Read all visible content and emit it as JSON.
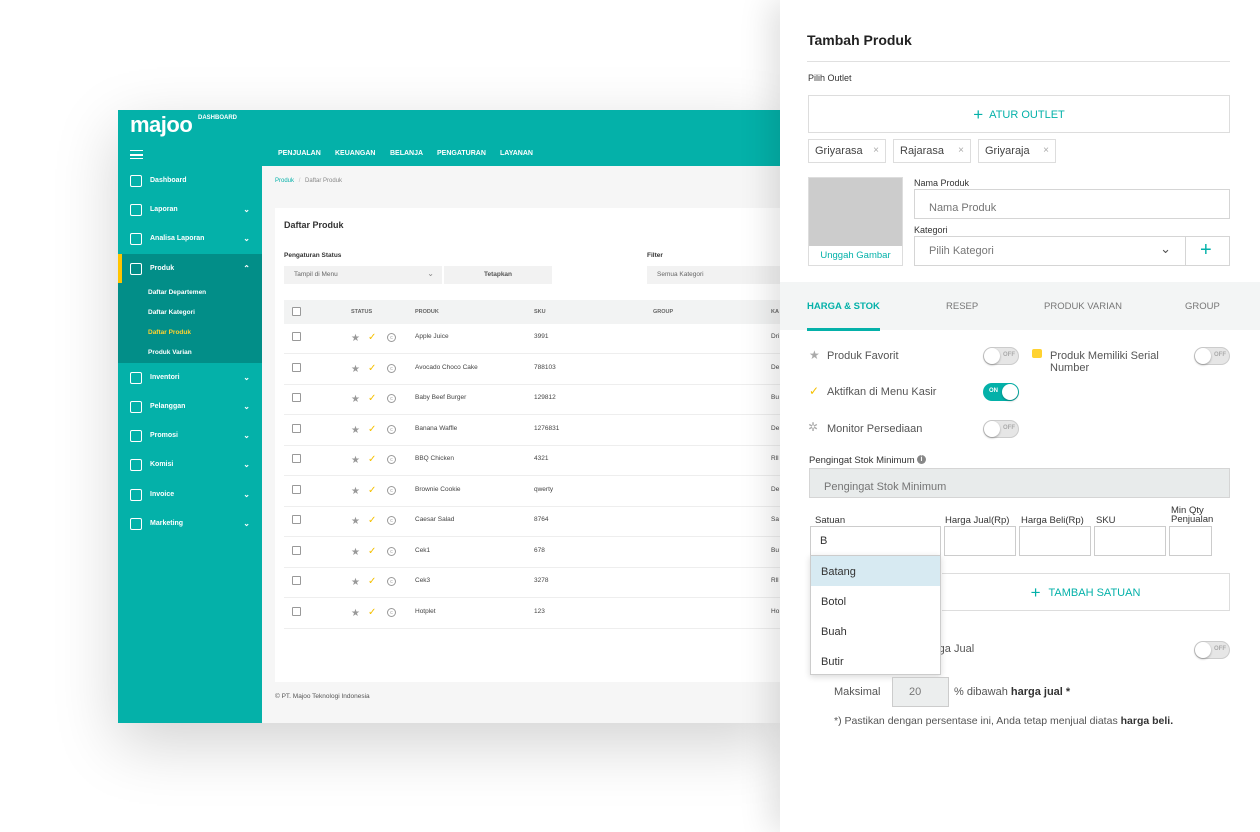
{
  "dashboard": {
    "logo": "majoo",
    "logo_sub": "DASHBOARD",
    "top_nav": [
      "PENJUALAN",
      "KEUANGAN",
      "BELANJA",
      "PENGATURAN",
      "LAYANAN"
    ],
    "sidebar": [
      {
        "label": "Dashboard",
        "icon": "grid-icon",
        "chevron": ""
      },
      {
        "label": "Laporan",
        "icon": "report-icon",
        "chevron": "⌄"
      },
      {
        "label": "Analisa Laporan",
        "icon": "analytics-icon",
        "chevron": "⌄"
      },
      {
        "label": "Produk",
        "icon": "bag-icon",
        "chevron": "⌃"
      },
      {
        "label": "Inventori",
        "icon": "inventory-icon",
        "chevron": "⌄"
      },
      {
        "label": "Pelanggan",
        "icon": "users-icon",
        "chevron": "⌄"
      },
      {
        "label": "Promosi",
        "icon": "ticket-icon",
        "chevron": "⌄"
      },
      {
        "label": "Komisi",
        "icon": "hand-coin-icon",
        "chevron": "⌄"
      },
      {
        "label": "Invoice",
        "icon": "dollar-icon",
        "chevron": "⌄"
      },
      {
        "label": "Marketing",
        "icon": "megaphone-icon",
        "chevron": "⌄"
      }
    ],
    "produk_sub": [
      "Daftar Departemen",
      "Daftar Kategori",
      "Daftar Produk",
      "Produk Varian"
    ],
    "breadcrumb": {
      "root": "Produk",
      "sep": "/",
      "current": "Daftar Produk"
    },
    "card_title": "Daftar Produk",
    "status_label": "Pengaturan Status",
    "status_value": "Tampil di Menu",
    "apply_label": "Tetapkan",
    "filter_label": "Filter",
    "filter_value": "Semua Kategori",
    "columns": [
      "STATUS",
      "PRODUK",
      "SKU",
      "GROUP",
      "KA"
    ],
    "rows": [
      {
        "produk": "Apple Juice",
        "sku": "3991",
        "ka": "Dri"
      },
      {
        "produk": "Avocado Choco Cake",
        "sku": "788103",
        "ka": "De"
      },
      {
        "produk": "Baby Beef Burger",
        "sku": "129812",
        "ka": "Bu"
      },
      {
        "produk": "Banana Waffle",
        "sku": "1276831",
        "ka": "De"
      },
      {
        "produk": "BBQ Chicken",
        "sku": "4321",
        "ka": "Rll"
      },
      {
        "produk": "Brownie Cookie",
        "sku": "qwerty",
        "ka": "De"
      },
      {
        "produk": "Caesar Salad",
        "sku": "8764",
        "ka": "Sa"
      },
      {
        "produk": "Cek1",
        "sku": "678",
        "ka": "Bu"
      },
      {
        "produk": "Cek3",
        "sku": "3278",
        "ka": "Rll"
      },
      {
        "produk": "Hotplet",
        "sku": "123",
        "ka": "Ho"
      }
    ],
    "footer": "© PT. Majoo Teknologi Indonesia",
    "colors": {
      "brand": "#04b1a9",
      "brand_dark": "#028e88",
      "accent": "#ffc400"
    }
  },
  "panel": {
    "title": "Tambah Produk",
    "pilih_outlet_label": "Pilih Outlet",
    "atur_outlet": "ATUR OUTLET",
    "outlets": [
      "Griyarasa",
      "Rajarasa",
      "Griyaraja"
    ],
    "chip_remove": "×",
    "upload_label": "Unggah Gambar",
    "nama_produk_label": "Nama Produk",
    "nama_produk_placeholder": "Nama Produk",
    "kategori_label": "Kategori",
    "kategori_placeholder": "Pilih Kategori",
    "tabs": [
      "HARGA & STOK",
      "RESEP",
      "PRODUK VARIAN",
      "GROUP"
    ],
    "produk_favorit": "Produk Favorit",
    "serial_number": "Produk Memiliki Serial Number",
    "aktifkan_menu": "Aktifkan di Menu Kasir",
    "monitor_persediaan": "Monitor Persediaan",
    "toggle_off": "OFF",
    "toggle_on": "ON",
    "pengingat_label": "Pengingat Stok Minimum",
    "pengingat_placeholder": "Pengingat Stok Minimum",
    "satuan_label": "Satuan",
    "harga_jual_label": "Harga Jual(Rp)",
    "harga_beli_label": "Harga Beli(Rp)",
    "sku_label": "SKU",
    "min_qty_label": "Min Qty Penjualan",
    "satuan_value": "B",
    "satuan_options": [
      "Batang",
      "Botol",
      "Buah",
      "Butir"
    ],
    "tambah_satuan": "TAMBAH SATUAN",
    "harga_jual_partial": "rga Jual",
    "maksimal_label": "Maksimal",
    "maksimal_value": "20",
    "percent_text": "% dibawah ",
    "percent_bold": "harga jual *",
    "note_text": "*) Pastikan dengan persentase ini, Anda tetap menjual diatas ",
    "note_bold": "harga beli."
  }
}
